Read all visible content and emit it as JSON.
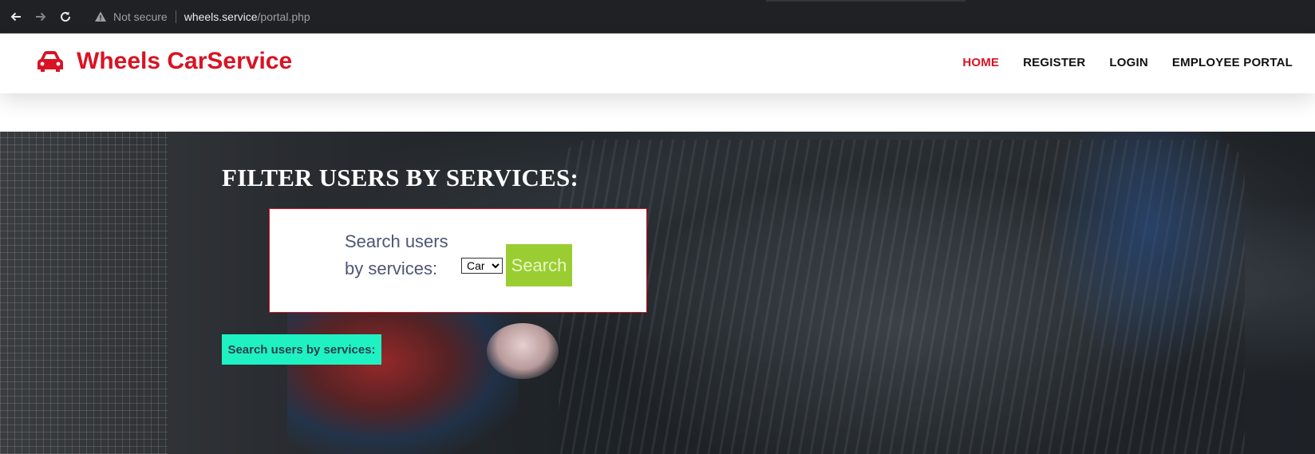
{
  "browser": {
    "security_label": "Not secure",
    "url_host": "wheels.service",
    "url_path": "/portal.php",
    "icons": [
      "back-icon",
      "forward-icon",
      "reload-icon",
      "warning-icon"
    ]
  },
  "navbar": {
    "brand": "Wheels CarService",
    "brand_icon": "car-icon",
    "brand_color": "#d81324",
    "items": [
      {
        "label": "HOME",
        "active": true
      },
      {
        "label": "REGISTER",
        "active": false
      },
      {
        "label": "LOGIN",
        "active": false
      },
      {
        "label": "EMPLOYEE PORTAL",
        "active": false
      }
    ]
  },
  "hero": {
    "heading": "FILTER USERS BY SERVICES:",
    "filter": {
      "label": "Search users by services:",
      "selected_service": "Car",
      "search_label": "Search",
      "search_color": "#9acd32"
    },
    "action_button": "Search users by services:",
    "action_color": "#1ef2c3"
  }
}
